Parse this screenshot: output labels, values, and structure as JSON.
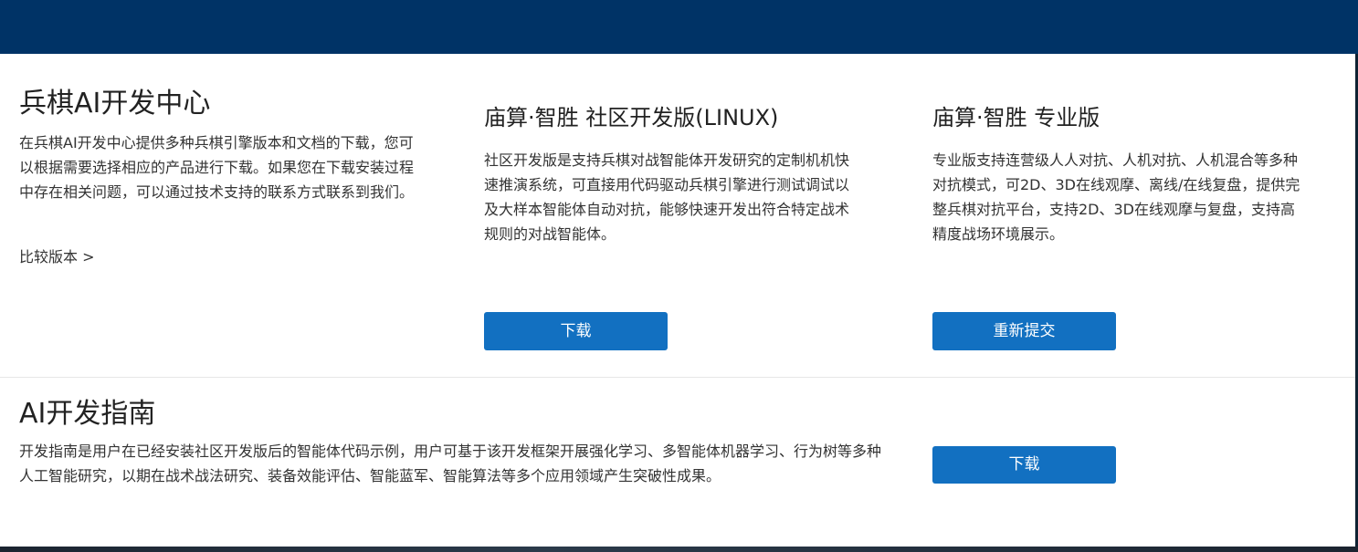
{
  "dev_center": {
    "title": "兵棋AI开发中心",
    "description": "在兵棋AI开发中心提供多种兵棋引擎版本和文档的下载，您可以根据需要选择相应的产品进行下载。如果您在下载安装过程中存在相关问题，可以通过技术支持的联系方式联系到我们。",
    "compare_link": "比较版本 >"
  },
  "community_edition": {
    "title": "庙算·智胜 社区开发版(LINUX)",
    "description": "社区开发版是支持兵棋对战智能体开发研究的定制机机快速推演系统，可直接用代码驱动兵棋引擎进行测试调试以及大样本智能体自动对抗，能够快速开发出符合特定战术规则的对战智能体。",
    "button_label": "下载"
  },
  "pro_edition": {
    "title": "庙算·智胜 专业版",
    "description": "专业版支持连营级人人对抗、人机对抗、人机混合等多种对抗模式，可2D、3D在线观摩、离线/在线复盘，提供完整兵棋对抗平台，支持2D、3D在线观摩与复盘，支持高精度战场环境展示。",
    "button_label": "重新提交"
  },
  "dev_guide": {
    "title": "AI开发指南",
    "description": "开发指南是用户在已经安装社区开发版后的智能体代码示例，用户可基于该开发框架开展强化学习、多智能体机器学习、行为树等多种人工智能研究，以期在战术战法研究、装备效能评估、智能蓝军、智能算法等多个应用领域产生突破性成果。",
    "button_label": "下载"
  },
  "colors": {
    "header": "#003366",
    "button": "#1270c1"
  }
}
